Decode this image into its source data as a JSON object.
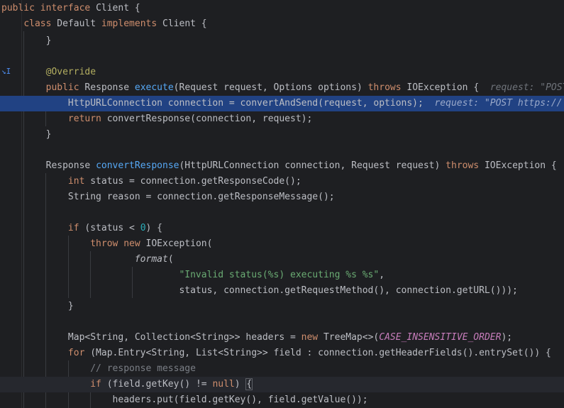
{
  "colors": {
    "background": "#1e1f22",
    "selection": "#214283",
    "keyword": "#cf8e6d",
    "function": "#56a8f5",
    "annotation": "#b3ae60",
    "number": "#2aacb8",
    "string": "#6aab73",
    "comment": "#7a7e85",
    "constant": "#c77dbb"
  },
  "gutter_icon": "step-into-breakpoint-icon",
  "code": {
    "iface_public": "public",
    "iface_interface": "interface",
    "iface_name": "Client {",
    "class_kw": "class",
    "class_name": "Default",
    "implements_kw": "implements",
    "class_rest": "Client {",
    "close1": "}",
    "override": "@Override",
    "exec_public": "public",
    "exec_type": "Response",
    "exec_name": "execute",
    "exec_params": "(Request request, Options options)",
    "exec_throws": "throws",
    "exec_rest": "IOException {",
    "exec_hint": "request: \"POST",
    "sel_code": "HttpURLConnection connection = convertAndSend(request, options);",
    "sel_hint": "request: \"POST https://",
    "ret_kw": "return",
    "ret_rest": "convertResponse(connection, request);",
    "close2": "}",
    "conv_type": "Response",
    "conv_name": "convertResponse",
    "conv_params": "(HttpURLConnection connection, Request request)",
    "conv_throws": "throws",
    "conv_rest": "IOException {",
    "status_int": "int",
    "status_rest": "status = connection.getResponseCode();",
    "reason_line": "String reason = connection.getResponseMessage();",
    "if_kw": "if",
    "if_open": "(status < ",
    "if_num": "0",
    "if_close": ") {",
    "throw_kw": "throw",
    "new_kw": "new",
    "throw_rest": "IOException(",
    "format_fn": "format",
    "format_paren": "(",
    "fmt_string": "\"Invalid status(%s) executing %s %s\"",
    "fmt_comma": ",",
    "args_line": "status, connection.getRequestMethod(), connection.getURL()));",
    "close3": "}",
    "map_decl": "Map<String, Collection<String>> headers = ",
    "map_new": "new",
    "map_tree": "TreeMap<>(",
    "map_const": "CASE_INSENSITIVE_ORDER",
    "map_end": ");",
    "for_kw": "for",
    "for_rest": "(Map.Entry<String, List<String>> field : connection.getHeaderFields().entrySet()) {",
    "comment": "// response message",
    "if2_kw": "if",
    "if2_mid": "(field.getKey() != ",
    "if2_null": "null",
    "if2_close": ")",
    "if2_brace": "{",
    "put_line": "headers.put(field.getKey(), field.getValue());"
  }
}
